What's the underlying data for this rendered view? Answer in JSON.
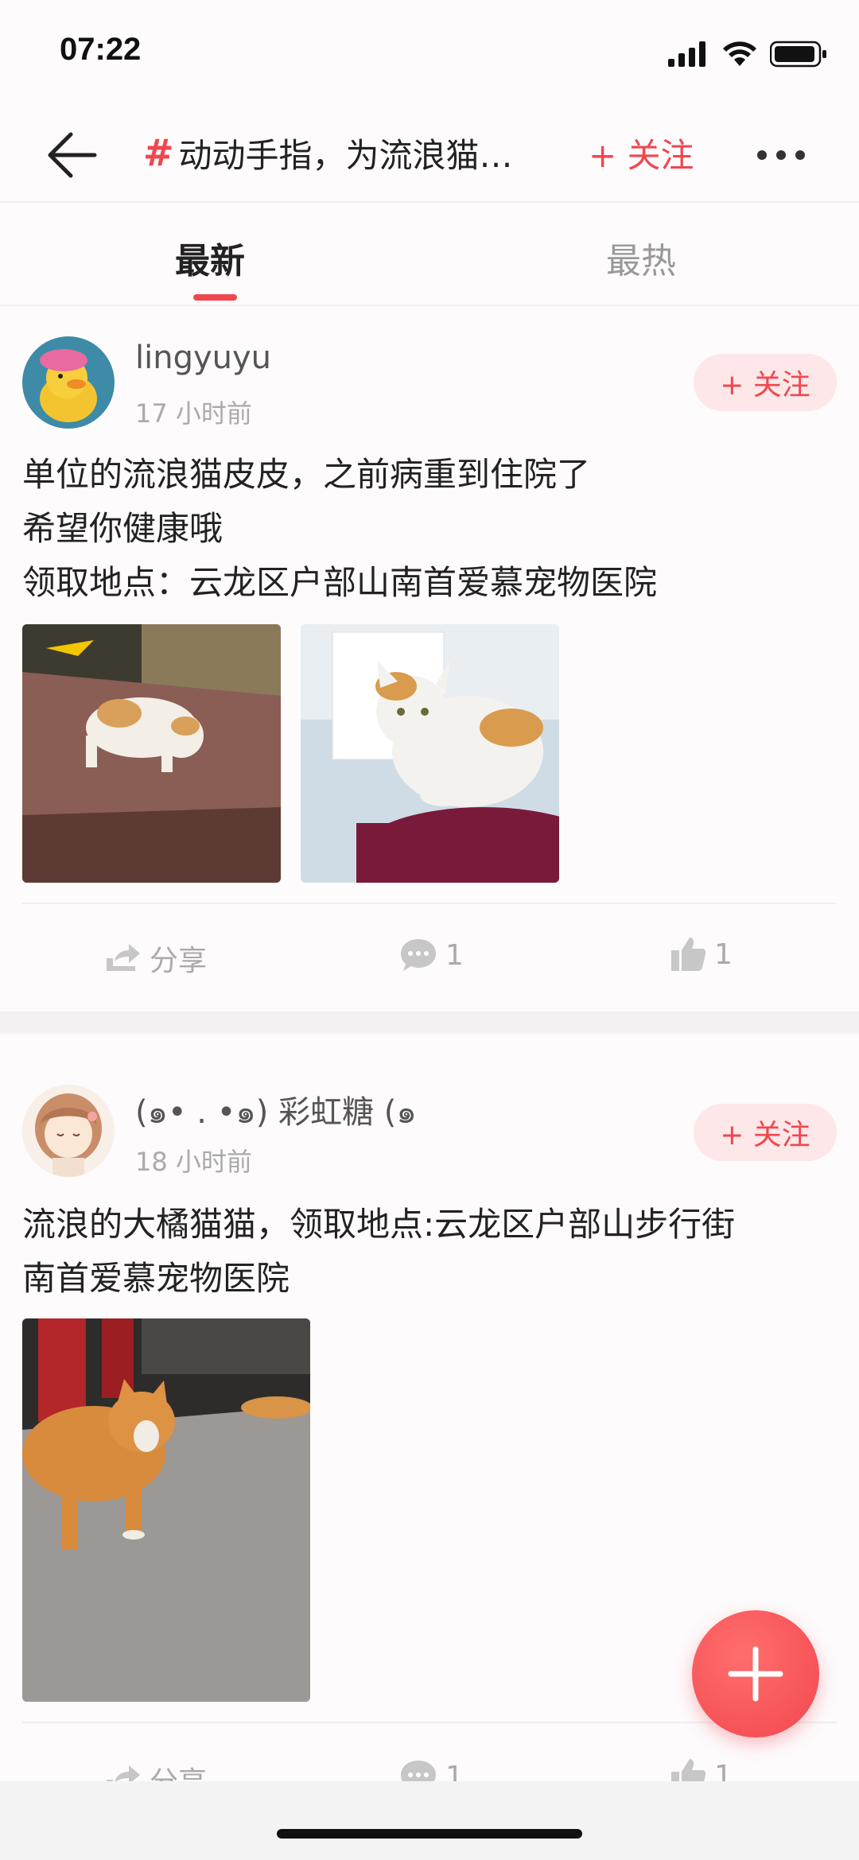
{
  "status_bar": {
    "time": "07:22"
  },
  "header": {
    "hash_symbol": "#",
    "title": "动动手指，为流浪猫…",
    "follow_label": "+ 关注"
  },
  "tabs": [
    {
      "label": "最新",
      "active": true
    },
    {
      "label": "最热",
      "active": false
    }
  ],
  "posts": [
    {
      "username": "lingyuyu",
      "time": "17 小时前",
      "follow_label": "+ 关注",
      "text_lines": [
        "单位的流浪猫皮皮，之前病重到住院了",
        "希望你健康哦",
        "领取地点：云龙区户部山南首爱慕宠物医院"
      ],
      "actions": {
        "share_label": "分享",
        "comments": "1",
        "likes": "1"
      }
    },
    {
      "username": "(๑• . •๑) 彩虹糖 (๑",
      "time": "18 小时前",
      "follow_label": "+ 关注",
      "text_lines": [
        "流浪的大橘猫猫，领取地点:云龙区户部山步行街",
        "南首爱慕宠物医院"
      ],
      "actions": {
        "share_label": "分享",
        "comments": "1",
        "likes": "1"
      }
    }
  ],
  "colors": {
    "accent": "#f0474f",
    "follow_bg": "#fde7e8"
  },
  "icons": [
    "back-arrow-icon",
    "more-dots-icon",
    "share-icon",
    "comment-icon",
    "like-icon",
    "plus-icon"
  ]
}
